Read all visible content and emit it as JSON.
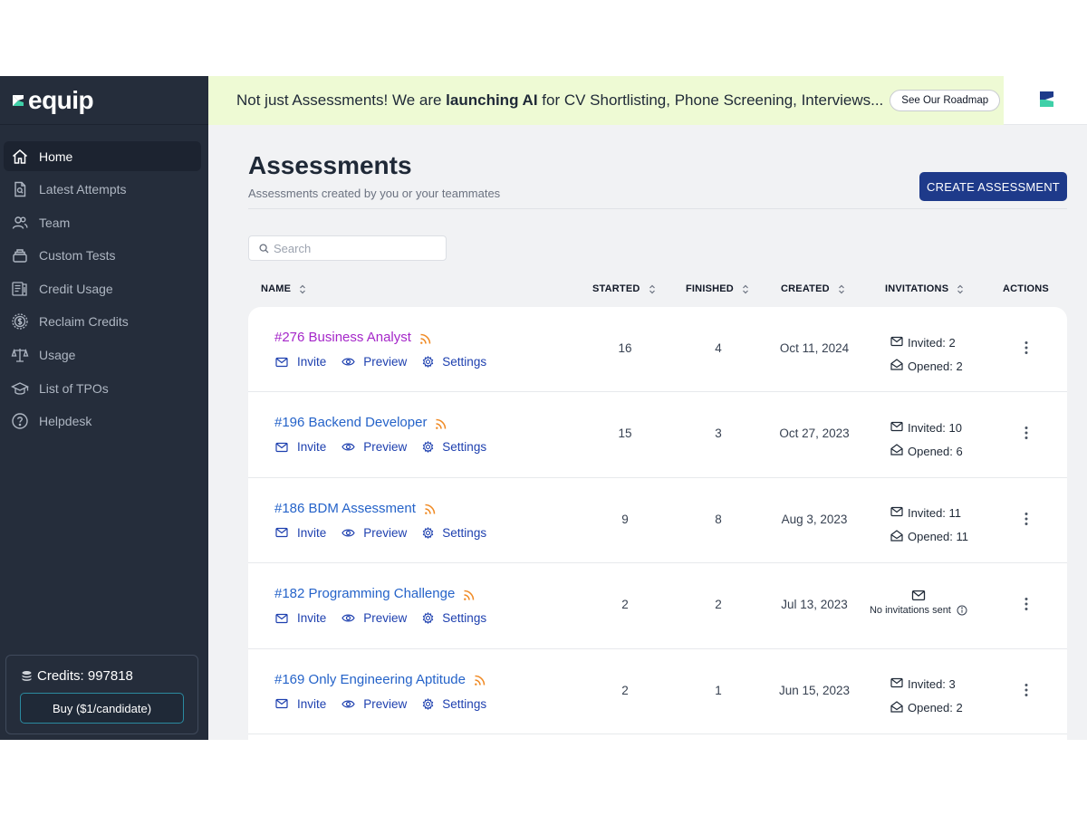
{
  "app": {
    "logo_text": "equip"
  },
  "colors": {
    "sidebar_bg": "#252d3b",
    "banner_bg": "#eefad4",
    "primary": "#1e3a8a",
    "link": "#2563c9",
    "visited_link": "#a527c9",
    "rss": "#f08a24"
  },
  "sidebar": {
    "items": [
      {
        "label": "Home",
        "icon": "home-icon",
        "active": true
      },
      {
        "label": "Latest Attempts",
        "icon": "document-search-icon"
      },
      {
        "label": "Team",
        "icon": "users-icon"
      },
      {
        "label": "Custom Tests",
        "icon": "stack-icon"
      },
      {
        "label": "Credit Usage",
        "icon": "receipt-icon"
      },
      {
        "label": "Reclaim Credits",
        "icon": "dollar-circle-icon"
      },
      {
        "label": "Usage",
        "icon": "scale-icon"
      },
      {
        "label": "List of TPOs",
        "icon": "graduation-cap-icon"
      },
      {
        "label": "Helpdesk",
        "icon": "help-circle-icon"
      }
    ],
    "credits_label": "Credits: 997818",
    "buy_label": "Buy ($1/candidate)"
  },
  "banner": {
    "text_before": "Not just Assessments! We are ",
    "text_bold": "launching AI",
    "text_after": " for CV Shortlisting, Phone Screening, Interviews...",
    "button_label": "See Our Roadmap"
  },
  "main": {
    "title": "Assessments",
    "subtitle": "Assessments created by you or your teammates",
    "create_button": "CREATE ASSESSMENT",
    "search_placeholder": "Search",
    "search_value": ""
  },
  "table": {
    "columns": {
      "name": "NAME",
      "started": "STARTED",
      "finished": "FINISHED",
      "created": "CREATED",
      "invitations": "INVITATIONS",
      "actions": "ACTIONS"
    },
    "row_actions": {
      "invite": "Invite",
      "preview": "Preview",
      "settings": "Settings"
    },
    "no_invitations_text": "No invitations sent",
    "rows": [
      {
        "name": "#276 Business Analyst",
        "visited": true,
        "started": "16",
        "finished": "4",
        "created": "Oct 11, 2024",
        "invited": "Invited: 2",
        "opened": "Opened: 2"
      },
      {
        "name": "#196 Backend Developer",
        "visited": false,
        "started": "15",
        "finished": "3",
        "created": "Oct 27, 2023",
        "invited": "Invited: 10",
        "opened": "Opened: 6"
      },
      {
        "name": "#186 BDM Assessment",
        "visited": false,
        "started": "9",
        "finished": "8",
        "created": "Aug 3, 2023",
        "invited": "Invited: 11",
        "opened": "Opened: 11"
      },
      {
        "name": "#182 Programming Challenge",
        "visited": false,
        "started": "2",
        "finished": "2",
        "created": "Jul 13, 2023",
        "invited": null,
        "opened": null
      },
      {
        "name": "#169 Only Engineering Aptitude",
        "visited": false,
        "started": "2",
        "finished": "1",
        "created": "Jun 15, 2023",
        "invited": "Invited: 3",
        "opened": "Opened: 2"
      }
    ]
  }
}
